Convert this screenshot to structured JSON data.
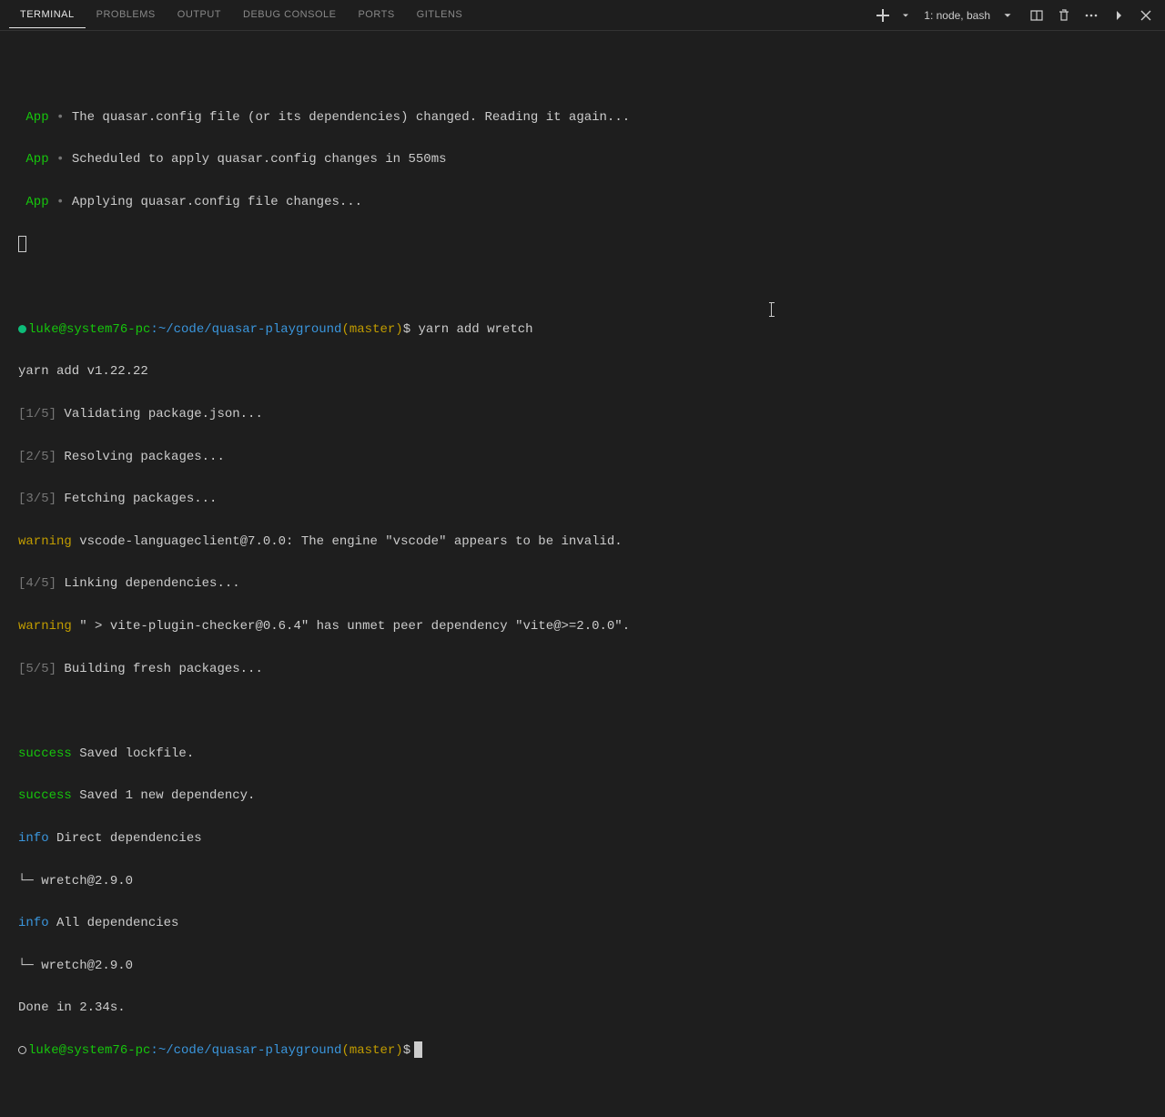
{
  "tabs": {
    "terminal": "TERMINAL",
    "problems": "PROBLEMS",
    "output": "OUTPUT",
    "debug": "DEBUG CONSOLE",
    "ports": "PORTS",
    "gitlens": "GITLENS"
  },
  "term_selector": "1: node, bash",
  "prompt": {
    "user_host": "luke@system76-pc",
    "path": ":~/code/quasar-playground",
    "branch": "(master)",
    "sym": "$"
  },
  "lines": {
    "app1": "The quasar.config file (or its dependencies) changed. Reading it again...",
    "app2": "Scheduled to apply quasar.config changes in 550ms",
    "app3": "Applying quasar.config file changes...",
    "app_label": " App ",
    "bullet": "•",
    "cmd": "yarn add wretch",
    "yarn_ver": "yarn add v1.22.22",
    "s1": "[1/5]",
    "s1t": " Validating package.json...",
    "s2": "[2/5]",
    "s2t": " Resolving packages...",
    "s3": "[3/5]",
    "s3t": " Fetching packages...",
    "w1l": "warning",
    "w1t": " vscode-languageclient@7.0.0: The engine \"vscode\" appears to be invalid.",
    "s4": "[4/5]",
    "s4t": " Linking dependencies...",
    "w2l": "warning",
    "w2t": " \" > vite-plugin-checker@0.6.4\" has unmet peer dependency \"vite@>=2.0.0\".",
    "s5": "[5/5]",
    "s5t": " Building fresh packages...",
    "suc1l": "success",
    "suc1t": " Saved lockfile.",
    "suc2l": "success",
    "suc2t": " Saved 1 new dependency.",
    "inf1l": "info",
    "inf1t": " Direct dependencies",
    "tree1": "└─ wretch@2.9.0",
    "inf2l": "info",
    "inf2t": " All dependencies",
    "tree2": "└─ wretch@2.9.0",
    "done": "Done in 2.34s."
  }
}
